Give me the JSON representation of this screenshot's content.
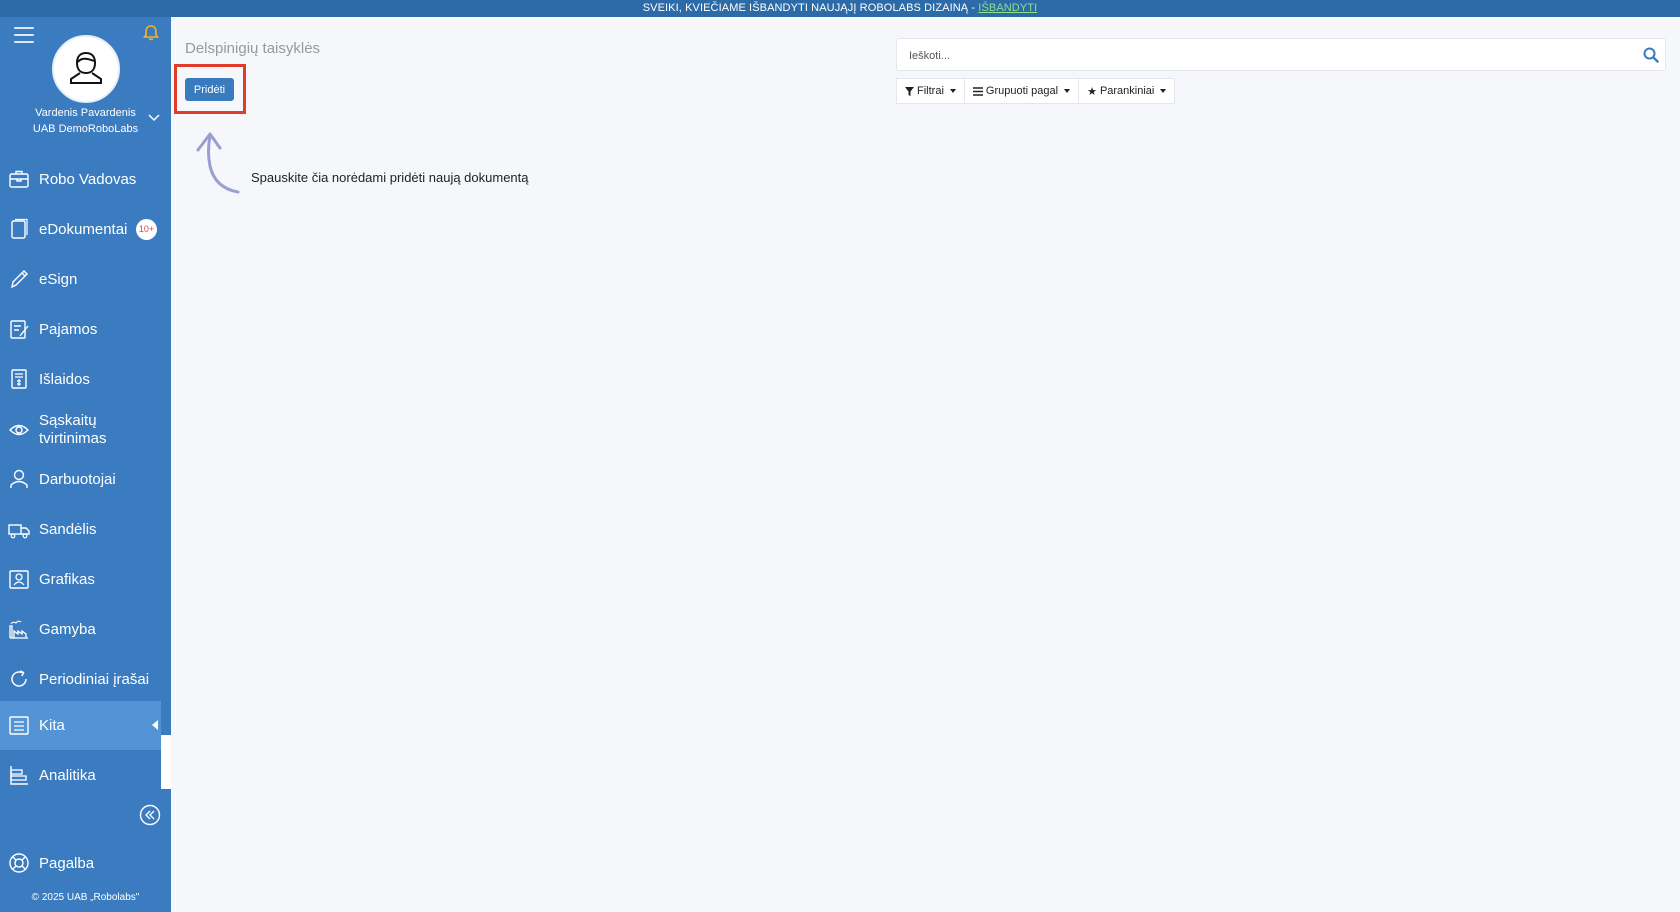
{
  "banner": {
    "text": "SVEIKI, KVIEČIAME IŠBANDYTI NAUJĄJĮ ROBOLABS DIZAINĄ - ",
    "link": "IŠBANDYTI"
  },
  "user": {
    "name": "Vardenis Pavardenis",
    "company": "UAB DemoRoboLabs"
  },
  "sidebar": {
    "items": [
      {
        "label": "Robo Vadovas",
        "icon": "briefcase-icon"
      },
      {
        "label": "eDokumentai",
        "icon": "documents-icon",
        "badge": "10+"
      },
      {
        "label": "eSign",
        "icon": "pen-icon"
      },
      {
        "label": "Pajamos",
        "icon": "income-icon"
      },
      {
        "label": "Išlaidos",
        "icon": "expenses-icon"
      },
      {
        "label": "Sąskaitų tvirtinimas",
        "icon": "eye-icon"
      },
      {
        "label": "Darbuotojai",
        "icon": "person-icon"
      },
      {
        "label": "Sandėlis",
        "icon": "truck-icon"
      },
      {
        "label": "Grafikas",
        "icon": "schedule-icon"
      },
      {
        "label": "Gamyba",
        "icon": "factory-icon"
      },
      {
        "label": "Periodiniai įrašai",
        "icon": "refresh-icon"
      },
      {
        "label": "Kita",
        "icon": "list-icon",
        "active": true
      },
      {
        "label": "Analitika",
        "icon": "analytics-icon"
      }
    ],
    "help": {
      "label": "Pagalba",
      "icon": "lifebuoy-icon"
    },
    "copyright": "© 2025 UAB „Robolabs\""
  },
  "main": {
    "title": "Delspinigių taisyklės",
    "add_button": "Pridėti",
    "hint": "Spauskite čia norėdami pridėti naują dokumentą"
  },
  "search": {
    "placeholder": "Ieškoti..."
  },
  "filters": {
    "filter_label": "Filtrai",
    "group_label": "Grupuoti pagal",
    "favorites_label": "Parankiniai"
  },
  "colors": {
    "sidebar": "#3b7cc0",
    "active_item": "#5394d6",
    "banner": "#2d6ba8",
    "highlight": "#e03b2b",
    "button": "#3a7bbf"
  }
}
